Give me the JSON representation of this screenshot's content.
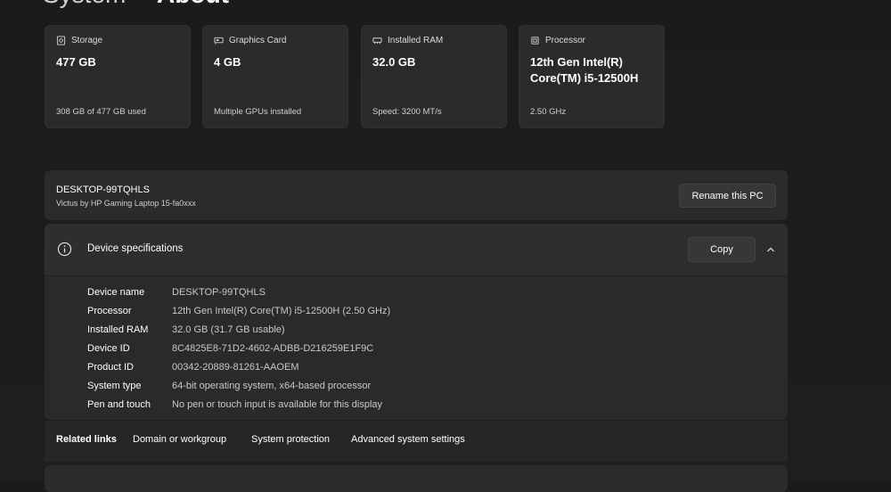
{
  "header": {
    "crumb": "System",
    "separator": "›",
    "title": "About"
  },
  "cards": [
    {
      "label": "Storage",
      "icon": "storage-icon",
      "value": "477 GB",
      "sub": "308 GB of 477 GB used"
    },
    {
      "label": "Graphics Card",
      "icon": "graphics-card-icon",
      "value": "4 GB",
      "sub": "Multiple GPUs installed"
    },
    {
      "label": "Installed RAM",
      "icon": "ram-icon",
      "value": "32.0 GB",
      "sub": "Speed: 3200 MT/s"
    },
    {
      "label": "Processor",
      "icon": "processor-icon",
      "value": "12th Gen Intel(R) Core(TM) i5-12500H",
      "sub": "2.50 GHz"
    }
  ],
  "pc": {
    "name": "DESKTOP-99TQHLS",
    "model": "Victus by HP Gaming Laptop 15-fa0xxx",
    "rename_label": "Rename this PC"
  },
  "specs": {
    "title": "Device specifications",
    "copy_label": "Copy",
    "rows": [
      {
        "key": "Device name",
        "value": "DESKTOP-99TQHLS"
      },
      {
        "key": "Processor",
        "value": "12th Gen Intel(R) Core(TM) i5-12500H (2.50 GHz)"
      },
      {
        "key": "Installed RAM",
        "value": "32.0 GB (31.7 GB usable)"
      },
      {
        "key": "Device ID",
        "value": "8C4825E8-71D2-4602-ADBB-D216259E1F9C"
      },
      {
        "key": "Product ID",
        "value": "00342-20889-81261-AAOEM"
      },
      {
        "key": "System type",
        "value": "64-bit operating system, x64-based processor"
      },
      {
        "key": "Pen and touch",
        "value": "No pen or touch input is available for this display"
      }
    ]
  },
  "related": {
    "title": "Related links",
    "links": [
      "Domain or workgroup",
      "System protection",
      "Advanced system settings"
    ]
  }
}
